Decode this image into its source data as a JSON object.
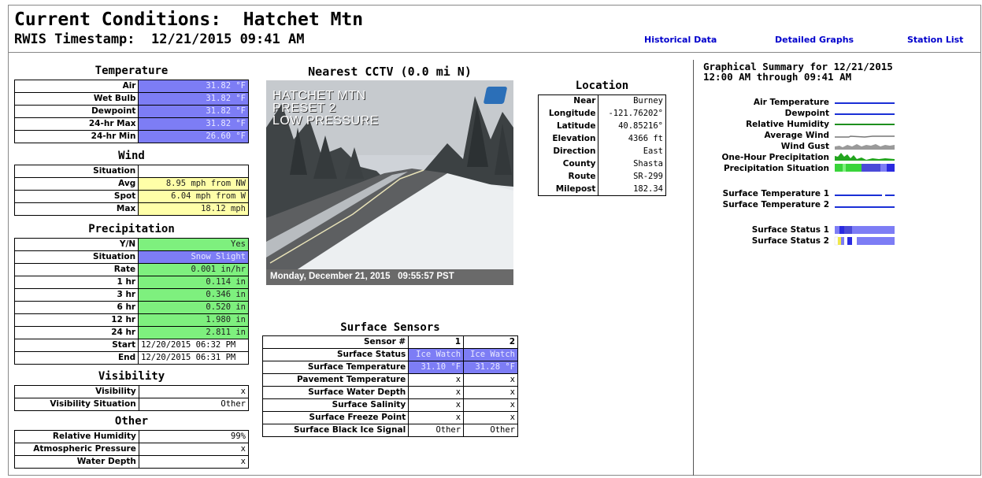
{
  "header": {
    "title": "Current Conditions:  Hatchet Mtn",
    "timestamp": "RWIS Timestamp:  12/21/2015 09:41 AM",
    "links": [
      "Historical Data",
      "Detailed Graphs",
      "Station List"
    ]
  },
  "temperature": {
    "title": "Temperature",
    "rows": [
      {
        "label": "Air",
        "value": "31.82 °F"
      },
      {
        "label": "Wet Bulb",
        "value": "31.82 °F"
      },
      {
        "label": "Dewpoint",
        "value": "31.82 °F"
      },
      {
        "label": "24-hr Max",
        "value": "31.82 °F"
      },
      {
        "label": "24-hr Min",
        "value": "26.60 °F"
      }
    ]
  },
  "wind": {
    "title": "Wind",
    "situation_label": "Situation",
    "situation_value": "",
    "rows": [
      {
        "label": "Avg",
        "value": "8.95 mph from NW"
      },
      {
        "label": "Spot",
        "value": "6.04 mph from W"
      },
      {
        "label": "Max",
        "value": "18.12 mph"
      }
    ]
  },
  "precipitation": {
    "title": "Precipitation",
    "yn_label": "Y/N",
    "yn_value": "Yes",
    "situation_label": "Situation",
    "situation_value": "Snow Slight",
    "rows": [
      {
        "label": "Rate",
        "value": "0.001 in/hr"
      },
      {
        "label": "1 hr",
        "value": "0.114 in"
      },
      {
        "label": "3 hr",
        "value": "0.346 in"
      },
      {
        "label": "6 hr",
        "value": "0.520 in"
      },
      {
        "label": "12 hr",
        "value": "1.980 in"
      },
      {
        "label": "24 hr",
        "value": "2.811 in"
      }
    ],
    "start_label": "Start",
    "start_value": "12/20/2015 06:32 PM",
    "end_label": "End",
    "end_value": "12/20/2015 06:31 PM"
  },
  "visibility": {
    "title": "Visibility",
    "rows": [
      {
        "label": "Visibility",
        "value": "x"
      },
      {
        "label": "Visibility Situation",
        "value": "Other"
      }
    ]
  },
  "other": {
    "title": "Other",
    "rows": [
      {
        "label": "Relative Humidity",
        "value": "99%"
      },
      {
        "label": "Atmospheric Pressure",
        "value": "x"
      },
      {
        "label": "Water Depth",
        "value": "x"
      }
    ]
  },
  "cctv": {
    "title": "Nearest CCTV (0.0 mi N)",
    "overlay_lines": [
      "HATCHET MTN",
      "PRESET 2",
      "LOW PRESSURE"
    ],
    "caption": "Monday, December 21, 2015   09:55:57 PST"
  },
  "location": {
    "title": "Location",
    "rows": [
      {
        "label": "Near",
        "value": "Burney"
      },
      {
        "label": "Longitude",
        "value": "-121.76202°"
      },
      {
        "label": "Latitude",
        "value": "40.85216°"
      },
      {
        "label": "Elevation",
        "value": "4366 ft"
      },
      {
        "label": "Direction",
        "value": "East"
      },
      {
        "label": "County",
        "value": "Shasta"
      },
      {
        "label": "Route",
        "value": "SR-299"
      },
      {
        "label": "Milepost",
        "value": "182.34"
      }
    ]
  },
  "surface": {
    "title": "Surface Sensors",
    "header": [
      "Sensor #",
      "1",
      "2"
    ],
    "rows": [
      {
        "label": "Surface Status",
        "v1": "Ice Watch",
        "v2": "Ice Watch"
      },
      {
        "label": "Surface Temperature",
        "v1": "31.10 °F",
        "v2": "31.28 °F"
      },
      {
        "label": "Pavement Temperature",
        "v1": "x",
        "v2": "x"
      },
      {
        "label": "Surface Water Depth",
        "v1": "x",
        "v2": "x"
      },
      {
        "label": "Surface Salinity",
        "v1": "x",
        "v2": "x"
      },
      {
        "label": "Surface Freeze Point",
        "v1": "x",
        "v2": "x"
      },
      {
        "label": "Surface Black Ice Signal",
        "v1": "Other",
        "v2": "Other"
      }
    ]
  },
  "graphical_summary": {
    "title_line1": "Graphical Summary for 12/21/2015",
    "title_line2": "12:00 AM through 09:41 AM",
    "rows": [
      "Air Temperature",
      "Dewpoint",
      "Relative Humidity",
      "Average Wind",
      "Wind Gust",
      "One-Hour Precipitation",
      "Precipitation Situation",
      "Surface Temperature 1",
      "Surface Temperature 2",
      "Surface Status 1",
      "Surface Status 2"
    ]
  },
  "colors": {
    "value_blue": "#7d7df5",
    "value_yellow": "#ffffa8",
    "value_green": "#7ef07e",
    "link": "#0000cc"
  }
}
